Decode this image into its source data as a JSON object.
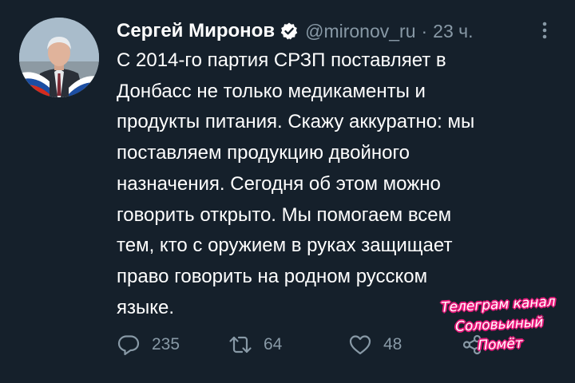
{
  "theme": {
    "background": "#15202b",
    "text": "#ffffff",
    "muted": "#8899a6",
    "verified_badge": "#ffffff",
    "watermark_outline": "#e6197a"
  },
  "tweet": {
    "author_name": "Сергей Миронов",
    "verified": true,
    "handle": "@mironov_ru",
    "separator": "·",
    "timestamp": "23 ч.",
    "text": "С 2014-го партия СРЗП поставляет в\nДонбасс не только медикаменты и\nпродукты питания. Скажу аккуратно: мы\nпоставляем продукцию двойного\nназначения. Сегодня об этом можно\nговорить открыто. Мы помогаем всем\nтем, кто с оружием в руках защищает\nправо говорить на родном русском\nязыке.",
    "actions": {
      "replies": "235",
      "retweets": "64",
      "likes": "48"
    }
  },
  "icons": {
    "avatar": "avatar-photo",
    "verified": "verified-badge-icon",
    "more": "more-vertical-icon",
    "reply": "reply-icon",
    "retweet": "retweet-icon",
    "like": "heart-icon",
    "share": "share-icon"
  },
  "watermark": {
    "line1": "Телеграм канал",
    "line2": "Соловьиный Помёт"
  }
}
